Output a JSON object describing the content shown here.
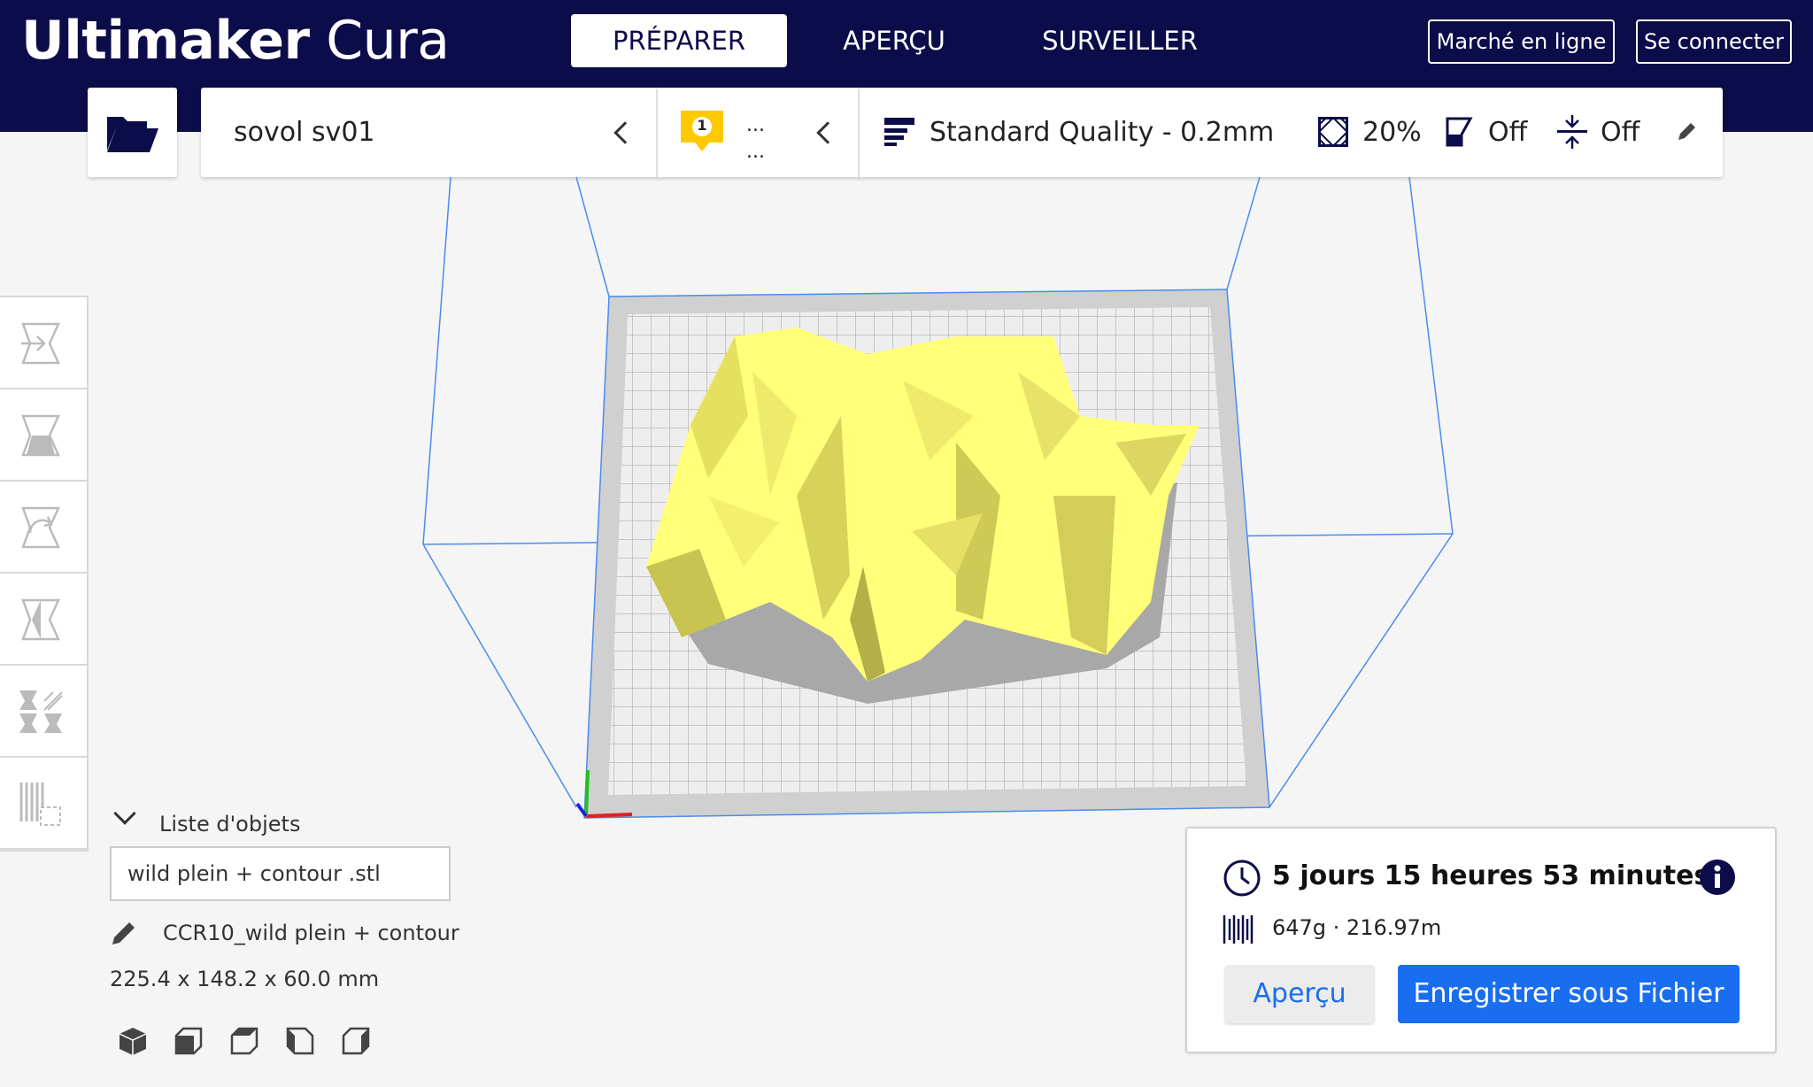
{
  "app": {
    "name_bold": "Ultimaker",
    "name_light": "Cura"
  },
  "stages": [
    {
      "label": "PRÉPARER",
      "active": true
    },
    {
      "label": "APERÇU",
      "active": false
    },
    {
      "label": "SURVEILLER",
      "active": false
    }
  ],
  "header_buttons": {
    "marketplace": "Marché en ligne",
    "signin": "Se connecter"
  },
  "printer": {
    "name": "sovol sv01"
  },
  "extruder": {
    "number": "1",
    "material_line1": "...",
    "material_line2": "..."
  },
  "print_setup": {
    "profile": "Standard Quality - 0.2mm",
    "infill": "20%",
    "support": "Off",
    "adhesion": "Off"
  },
  "object_list": {
    "title": "Liste d'objets",
    "file": "wild plein + contour .stl",
    "job_name": "CCR10_wild plein + contour",
    "dimensions": "225.4 x 148.2 x 60.0 mm"
  },
  "print_info": {
    "time": "5 jours 15 heures 53 minutes",
    "material": "647g · 216.97m",
    "preview_button": "Aperçu",
    "save_button": "Enregistrer sous Fichier"
  },
  "colors": {
    "header_bg": "#0d0c4a",
    "accent_blue": "#196ef0",
    "model_yellow": "#ffff7a",
    "warning_yellow": "#ffc900"
  },
  "icons": {
    "open_file": "folder-open-icon",
    "profile": "quality-lines-icon",
    "infill": "infill-icon",
    "support": "support-icon",
    "adhesion": "adhesion-icon",
    "edit": "pencil-icon",
    "time": "clock-icon",
    "material": "spool-icon",
    "info": "info-icon",
    "tools": [
      "move-tool-icon",
      "scale-tool-icon",
      "rotate-tool-icon",
      "mirror-tool-icon",
      "per-model-settings-icon",
      "support-blocker-icon"
    ],
    "camera": [
      "camera-3d-icon",
      "camera-front-icon",
      "camera-top-icon",
      "camera-left-icon",
      "camera-right-icon"
    ]
  }
}
